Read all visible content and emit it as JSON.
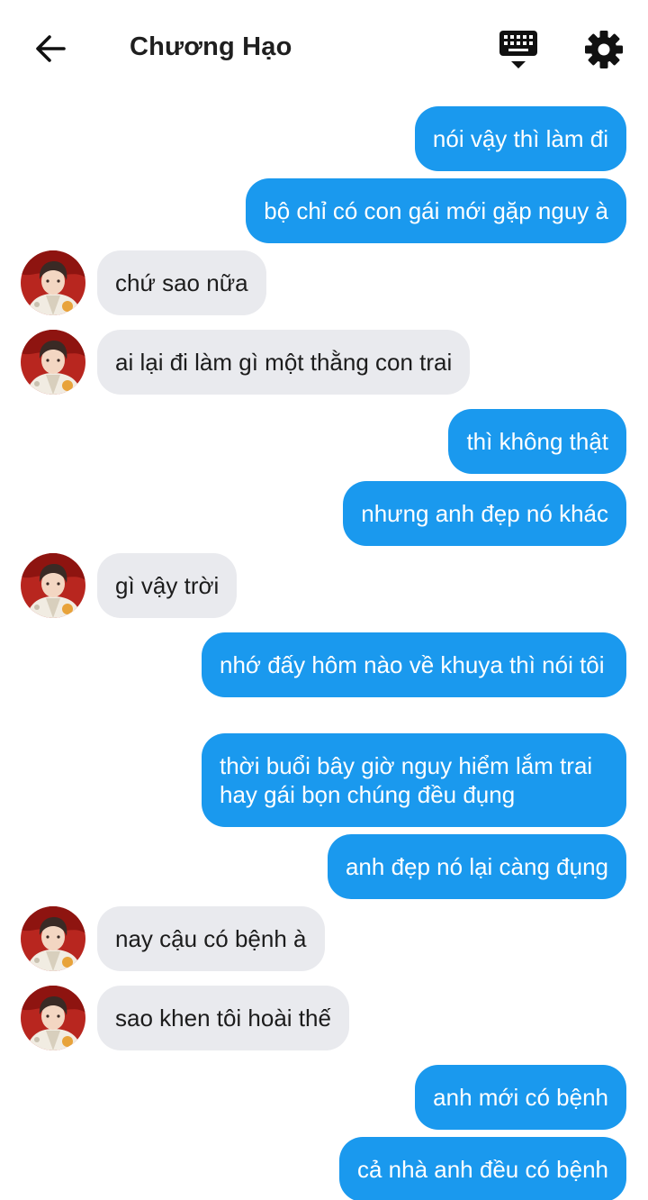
{
  "header": {
    "contact_name": "Chương Hạo",
    "back_icon": "arrow-left-icon",
    "keyboard_icon": "keyboard-icon",
    "settings_icon": "gear-icon"
  },
  "colors": {
    "outgoing_bubble": "#1a99ee",
    "incoming_bubble": "#e9eaee"
  },
  "messages": [
    {
      "from": "me",
      "text": "nói vậy thì làm đi"
    },
    {
      "from": "me",
      "text": "bộ chỉ có con gái mới gặp nguy à"
    },
    {
      "from": "them",
      "text": "chứ sao nữa"
    },
    {
      "from": "them",
      "text": "ai lại đi làm gì một thằng con trai"
    },
    {
      "from": "me",
      "text": "thì không thật"
    },
    {
      "from": "me",
      "text": "nhưng anh đẹp nó khác"
    },
    {
      "from": "them",
      "text": "gì vậy trời"
    },
    {
      "from": "me",
      "text": "nhớ đấy hôm nào về khuya thì nói tôi"
    },
    {
      "from": "me",
      "text": "thời buổi bây giờ nguy hiểm lắm trai hay gái bọn chúng đều đụng"
    },
    {
      "from": "me",
      "text": "anh đẹp nó lại càng đụng"
    },
    {
      "from": "them",
      "text": "nay cậu có bệnh à"
    },
    {
      "from": "them",
      "text": "sao khen tôi hoài thế"
    },
    {
      "from": "me",
      "text": "anh mới có bệnh"
    },
    {
      "from": "me",
      "text": "cả nhà anh đều có bệnh"
    }
  ]
}
